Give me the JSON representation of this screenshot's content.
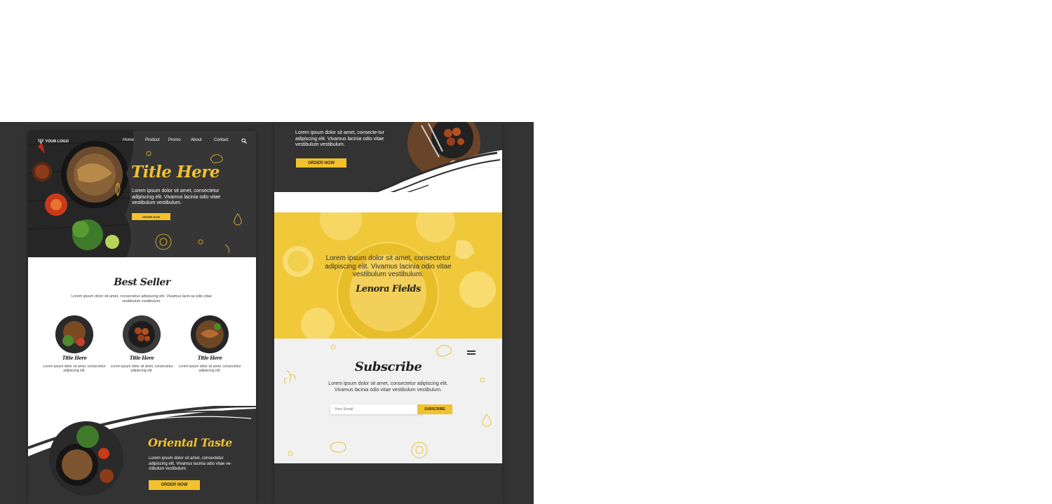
{
  "page1": {
    "logo": "YOUR LOGO",
    "nav": [
      "Home",
      "Product",
      "Promo",
      "About",
      "Contact"
    ],
    "hero": {
      "title": "Title Here",
      "text": "Lorem ipsum dolor sit amet, consectetur adipiscing elit. Vivamus lacinia odio vitae vestibulum vestibulum.",
      "button": "ORDER NOW"
    },
    "best_seller": {
      "title": "Best Seller",
      "text": "Lorem ipsum dolor sit amet, consectetur adipiscing elit. Vivamus lacin-ia odio vitae vestibulum vestibulum.",
      "items": [
        {
          "title": "Title Here",
          "text": "Lorem ipsum dolor sit amet, consectetur adipiscing elit."
        },
        {
          "title": "Title Here",
          "text": "Lorem ipsum dolor sit amet, consectetur adipiscing elit."
        },
        {
          "title": "Title Here",
          "text": "Lorem ipsum dolor sit amet, consectetur adipiscing elit."
        }
      ]
    },
    "oriental": {
      "title": "Oriental Taste",
      "text": "Lorem ipsum dolor sit amet, consectetur adipiscing elit. Vivamus lacinia odio vitae ve-stibulum vestibulum.",
      "button": "ORDER NOW"
    }
  },
  "page2": {
    "top": {
      "text": "Lorem ipsum dolor sit amet, consecte-tur adipiscing elit. Vivamus lacinia odio vitae vestibulum vestibulum.",
      "button": "ORDER NOW"
    },
    "testimonial": {
      "text": "Lorem ipsum dolor sit amet, consectetur adipiscing elit. Vivamus lacinia odio vitae vestibulum vestibulum.",
      "name": "Lenora Fields"
    },
    "subscribe": {
      "title": "Subscribe",
      "text": "Lorem ipsum dolor sit amet, consectetur adipiscing elit. Vivamus lacinia odio vitae vestibulum vestibulum.",
      "placeholder": "Your Email",
      "button": "SUBSCRIBE"
    }
  },
  "colors": {
    "accent": "#f2c12e",
    "dark": "#333333"
  },
  "icons": [
    "fork-knife-logo-icon",
    "search-icon",
    "chili-icon",
    "leaf-icon",
    "onion-icon",
    "chicken-icon",
    "flag-icon"
  ]
}
